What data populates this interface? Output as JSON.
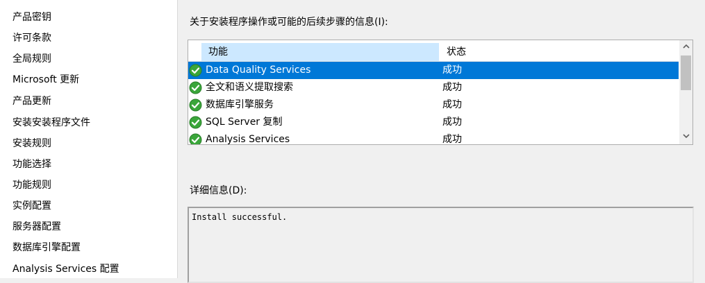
{
  "sidebar": {
    "items": [
      {
        "label": "产品密钥"
      },
      {
        "label": "许可条款"
      },
      {
        "label": "全局规则"
      },
      {
        "label": "Microsoft 更新"
      },
      {
        "label": "产品更新"
      },
      {
        "label": "安装安装程序文件"
      },
      {
        "label": "安装规则"
      },
      {
        "label": "功能选择"
      },
      {
        "label": "功能规则"
      },
      {
        "label": "实例配置"
      },
      {
        "label": "服务器配置"
      },
      {
        "label": "数据库引擎配置"
      },
      {
        "label": "Analysis Services 配置"
      }
    ]
  },
  "main": {
    "heading": "关于安装程序操作或可能的后续步骤的信息(I):",
    "table": {
      "columns": [
        "功能",
        "状态"
      ],
      "rows": [
        {
          "name": "Data Quality Services",
          "status": "成功",
          "selected": true
        },
        {
          "name": "全文和语义提取搜索",
          "status": "成功",
          "selected": false
        },
        {
          "name": "数据库引擎服务",
          "status": "成功",
          "selected": false
        },
        {
          "name": "SQL Server 复制",
          "status": "成功",
          "selected": false
        },
        {
          "name": "Analysis Services",
          "status": "成功",
          "selected": false
        }
      ]
    },
    "details_label": "详细信息(D):",
    "details_text": "Install successful."
  },
  "icons": {
    "status": "success-check-icon",
    "scroll_up": "chevron-up-icon",
    "scroll_down": "chevron-down-icon"
  },
  "colors": {
    "selection": "#0078d7",
    "header_highlight": "#cce8ff",
    "success_green": "#3aa63a"
  }
}
